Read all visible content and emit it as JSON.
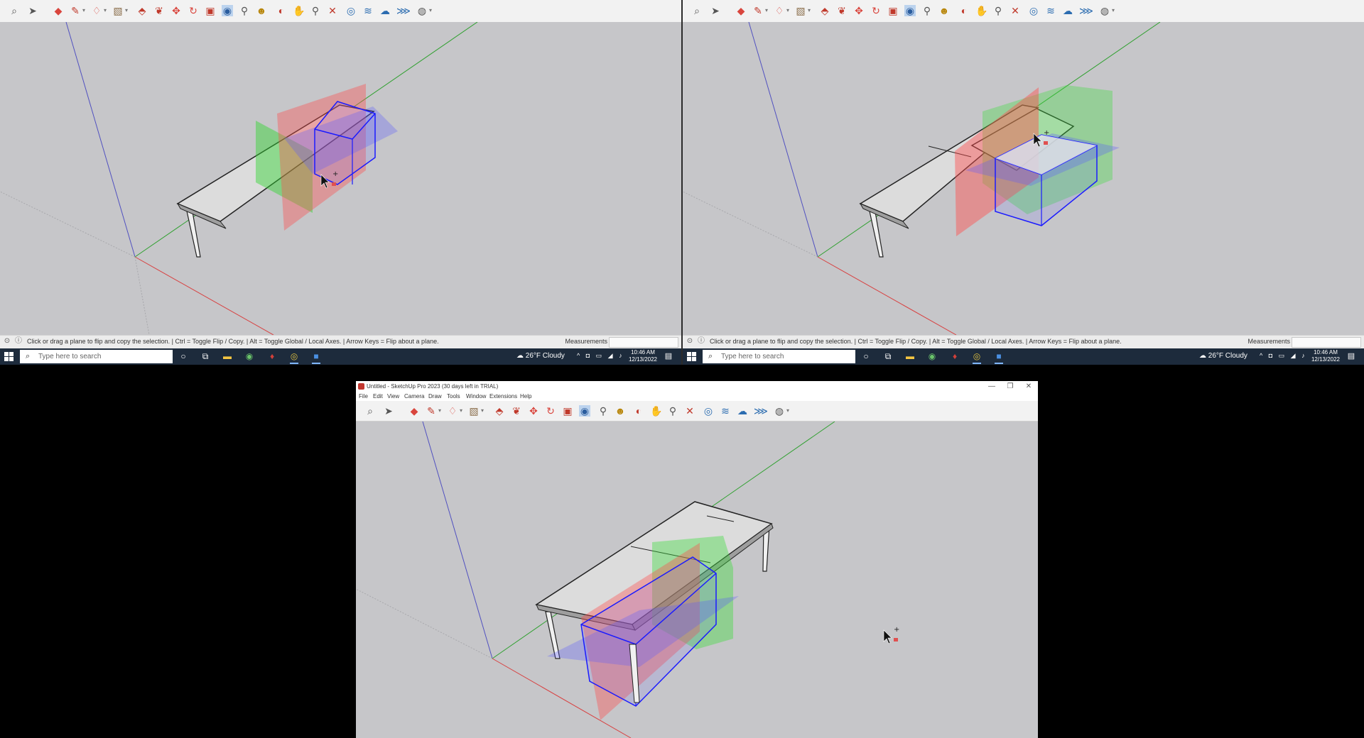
{
  "colors": {
    "taskbar": "#1d2b3c",
    "viewport": "#c6c6c9",
    "selection": "#1a1aff",
    "plane_red": "#ff5050",
    "plane_green": "#3ddc3d",
    "plane_blue": "#6b6bff"
  },
  "toolbar_icons": [
    "zoom-icon",
    "select-icon",
    "eraser-icon",
    "pencil-icon",
    "lasso-icon",
    "paint-icon",
    "pushpull-icon",
    "flip-icon",
    "move-icon",
    "rotate-icon",
    "scale-icon",
    "orbit-icon",
    "tape-icon",
    "walk-icon",
    "shield-icon",
    "extension-icon",
    "mirror-icon",
    "zoom-window-icon",
    "zoom-extents-icon",
    "layer-icon",
    "dynamic-icon",
    "cloud-icon",
    "export-icon",
    "help-icon"
  ],
  "status": {
    "text": "Click or drag a plane to flip and copy the selection. | Ctrl = Toggle Flip / Copy. | Alt = Toggle Global / Local Axes. | Arrow Keys = Flip about a plane.",
    "measurements_label": "Measurements"
  },
  "taskbar": {
    "search_placeholder": "Type here to search",
    "weather": "26°F  Cloudy",
    "time": "10:46 AM",
    "date": "12/13/2022",
    "tray": "^ ◘ ▭ ◢ ♪"
  },
  "window": {
    "title": "Untitled - SketchUp Pro 2023 (30 days left in TRIAL)",
    "menu": [
      "File",
      "Edit",
      "View",
      "Camera",
      "Draw",
      "Tools",
      "Window",
      "Extensions",
      "Help"
    ],
    "minimize": "—",
    "restore": "❐",
    "close": "✕"
  }
}
